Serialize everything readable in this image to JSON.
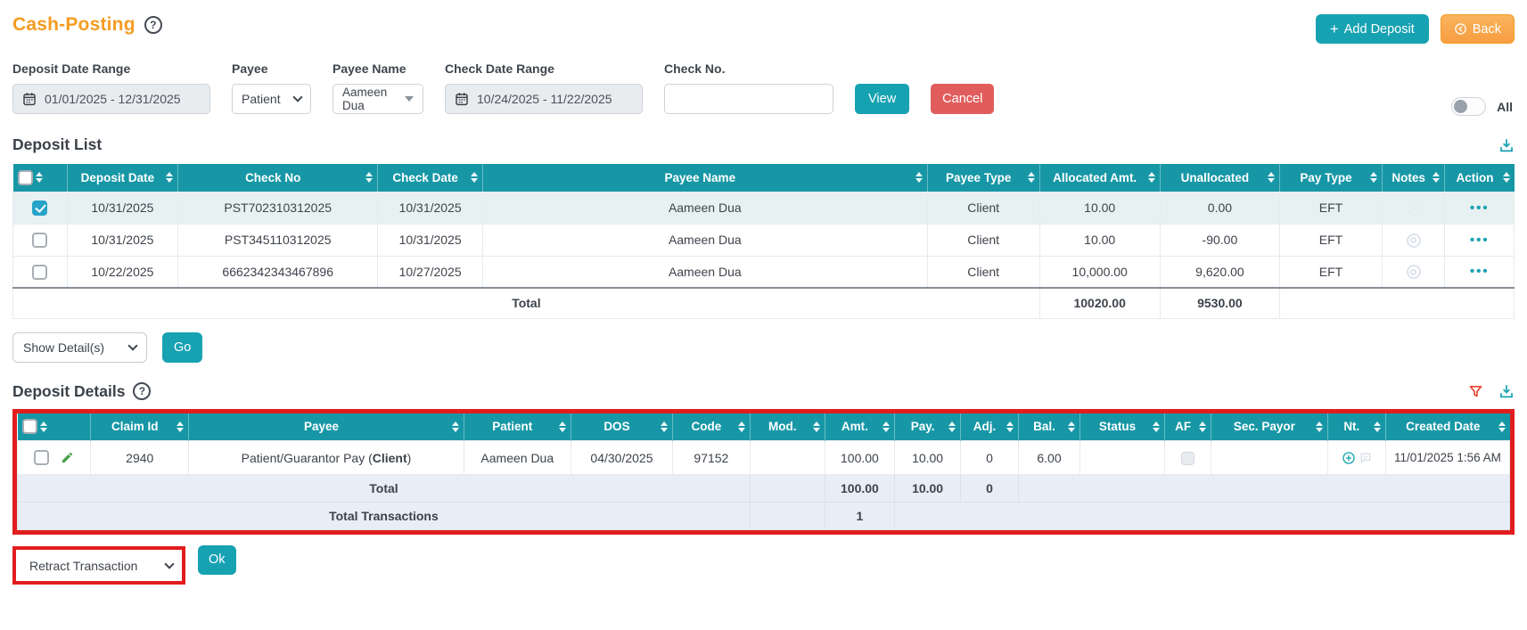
{
  "header": {
    "title": "Cash-Posting",
    "add_deposit": "Add Deposit",
    "add_deposit_plus": "+",
    "back": "Back"
  },
  "filters": {
    "deposit_date_range_label": "Deposit Date Range",
    "deposit_date_range_value": "01/01/2025 - 12/31/2025",
    "payee_label": "Payee",
    "payee_value": "Patient",
    "payee_name_label": "Payee Name",
    "payee_name_value": "Aameen Dua",
    "check_date_range_label": "Check Date Range",
    "check_date_range_value": "10/24/2025 - 11/22/2025",
    "check_no_label": "Check No.",
    "check_no_value": "",
    "view": "View",
    "cancel": "Cancel",
    "all_label": "All"
  },
  "deposit_list": {
    "title": "Deposit List",
    "columns": {
      "deposit_date": "Deposit Date",
      "check_no": "Check No",
      "check_date": "Check Date",
      "payee_name": "Payee Name",
      "payee_type": "Payee Type",
      "allocated_amt": "Allocated Amt.",
      "unallocated": "Unallocated",
      "pay_type": "Pay Type",
      "notes": "Notes",
      "action": "Action"
    },
    "rows": [
      {
        "checked": true,
        "deposit_date": "10/31/2025",
        "check_no": "PST702310312025",
        "check_date": "10/31/2025",
        "payee_name": "Aameen Dua",
        "payee_type": "Client",
        "allocated_amt": "10.00",
        "unallocated": "0.00",
        "pay_type": "EFT",
        "action": "•••"
      },
      {
        "checked": false,
        "deposit_date": "10/31/2025",
        "check_no": "PST345110312025",
        "check_date": "10/31/2025",
        "payee_name": "Aameen Dua",
        "payee_type": "Client",
        "allocated_amt": "10.00",
        "unallocated": "-90.00",
        "pay_type": "EFT",
        "action": "•••"
      },
      {
        "checked": false,
        "deposit_date": "10/22/2025",
        "check_no": "6662342343467896",
        "check_date": "10/27/2025",
        "payee_name": "Aameen Dua",
        "payee_type": "Client",
        "allocated_amt": "10,000.00",
        "unallocated": "9,620.00",
        "pay_type": "EFT",
        "action": "•••"
      }
    ],
    "total": {
      "label": "Total",
      "allocated_amt": "10020.00",
      "unallocated": "9530.00"
    }
  },
  "detail_select": {
    "value": "Show Detail(s)",
    "go": "Go"
  },
  "deposit_details": {
    "title": "Deposit Details",
    "columns": {
      "claim_id": "Claim Id",
      "payee": "Payee",
      "patient": "Patient",
      "dos": "DOS",
      "code": "Code",
      "mod": "Mod.",
      "amt": "Amt.",
      "pay": "Pay.",
      "adj": "Adj.",
      "bal": "Bal.",
      "status": "Status",
      "af": "AF",
      "sec_payor": "Sec. Payor",
      "nt": "Nt.",
      "created_date": "Created Date"
    },
    "row": {
      "claim_id": "2940",
      "payee_prefix": "Patient/Guarantor Pay (",
      "payee_bold": "Client",
      "payee_suffix": ")",
      "patient": "Aameen Dua",
      "dos": "04/30/2025",
      "code": "97152",
      "mod": "",
      "amt": "100.00",
      "pay": "10.00",
      "adj": "0",
      "bal": "6.00",
      "status": "",
      "sec_payor": "",
      "created_date": "11/01/2025 1:56 AM"
    },
    "total": {
      "label": "Total",
      "amt": "100.00",
      "pay": "10.00",
      "adj": "0"
    },
    "total_transactions": {
      "label": "Total Transactions",
      "value": "1"
    }
  },
  "transaction_select": {
    "value": "Retract Transaction",
    "ok": "Ok"
  },
  "colors": {
    "table_header_teal": "#1797a6",
    "button_teal": "#17a2b2",
    "title_orange": "#f49c20",
    "back_orange": "#f79d40",
    "cancel_red": "#e15d5d",
    "highlight_red": "#e11d1d",
    "selected_row": "#e8f1f1",
    "totals_row_blue": "#e9edf6"
  }
}
